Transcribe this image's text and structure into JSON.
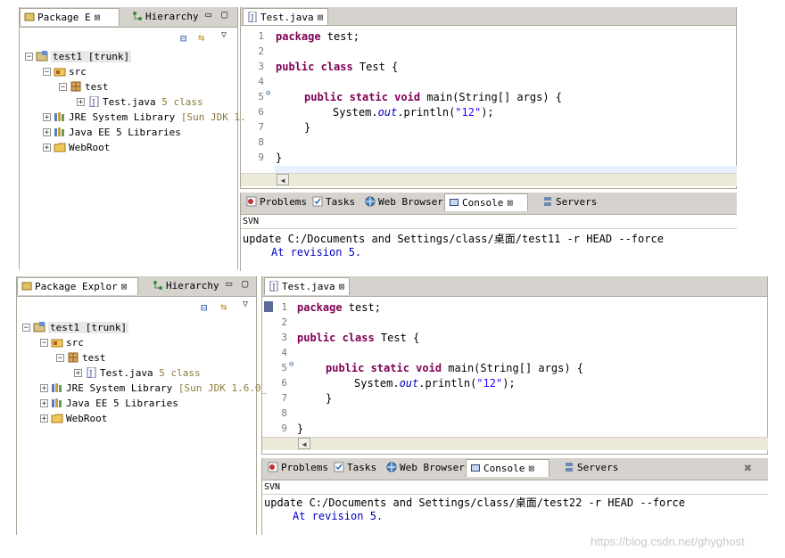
{
  "top": {
    "explorer_tab": "Package E",
    "hierarchy_tab": "Hierarchy",
    "project": "test1 [trunk]",
    "src": "src",
    "package": "test",
    "file": "Test.java",
    "file_rev": "5",
    "file_author": "class",
    "jre": "JRE System Library",
    "jre_detail": "[Sun JDK 1.",
    "javaee": "Java EE 5 Libraries",
    "webroot": "WebRoot",
    "editor_tab": "Test.java",
    "bottom_tabs": [
      "Problems",
      "Tasks",
      "Web Browser",
      "Console",
      "Servers"
    ],
    "console_header": "SVN",
    "console_lines": [
      "update C:/Documents and Settings/class/桌面/test11 -r HEAD --force",
      "At revision 5."
    ]
  },
  "bottom": {
    "explorer_tab": "Package Explor",
    "hierarchy_tab": "Hierarchy",
    "project": "test1 [trunk]",
    "src": "src",
    "package": "test",
    "file": "Test.java",
    "file_rev": "5",
    "file_author": "class",
    "jre": "JRE System Library",
    "jre_detail": "[Sun JDK 1.6.0_",
    "javaee": "Java EE 5 Libraries",
    "webroot": "WebRoot",
    "editor_tab": "Test.java",
    "bottom_tabs": [
      "Problems",
      "Tasks",
      "Web Browser",
      "Console",
      "Servers"
    ],
    "console_header": "SVN",
    "console_lines": [
      "update C:/Documents and Settings/class/桌面/test22 -r HEAD --force",
      "At revision 5."
    ]
  },
  "code": {
    "line_numbers": [
      "1",
      "2",
      "3",
      "4",
      "5",
      "6",
      "7",
      "8",
      "9"
    ],
    "l1_kw": "package",
    "l1_rest": " test;",
    "l3_kw": "public class",
    "l3_rest": " Test {",
    "l5_kw": "public static void",
    "l5_rest": " main(String[] args) {",
    "l6_a": "System.",
    "l6_field": "out",
    "l6_b": ".println(",
    "l6_str": "\"12\"",
    "l6_c": ");",
    "l7": "}",
    "l9": "}"
  },
  "watermark": "https://blog.csdn.net/ghyghost"
}
